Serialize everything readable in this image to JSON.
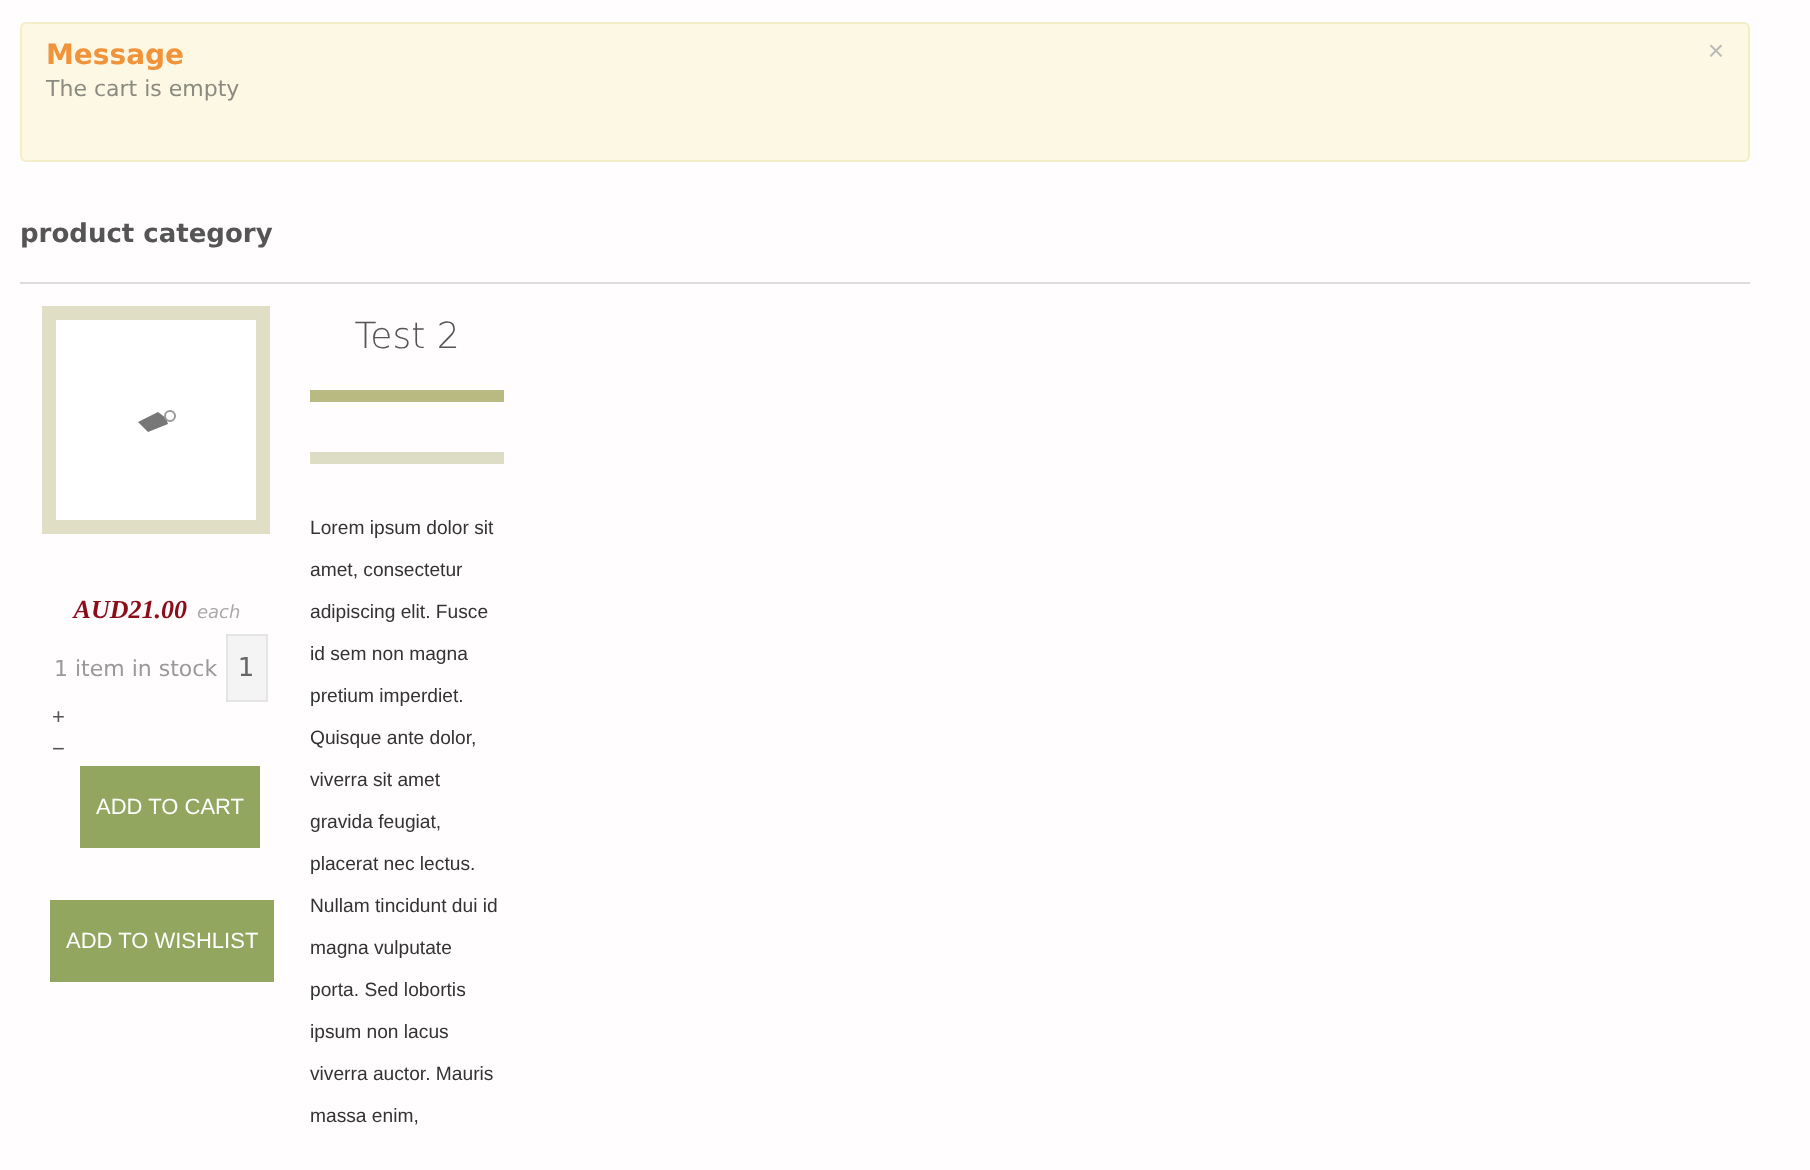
{
  "message": {
    "title": "Message",
    "text": "The cart is empty",
    "close": "×"
  },
  "category": {
    "title": "product category"
  },
  "product": {
    "name": "Test 2",
    "price": "AUD21.00",
    "unit": "each",
    "stock": "1 item in stock",
    "quantity": "1",
    "increase": "+",
    "decrease": "−",
    "buttons": [
      "ADD TO CART",
      "ADD TO WISHLIST"
    ],
    "description": "Lorem ipsum dolor sit amet, consectetur adipiscing elit. Fusce id sem non magna pretium imperdiet. Quisque ante dolor, viverra sit amet gravida feugiat, placerat nec lectus. Nullam tincidunt dui id magna vulputate porta. Sed lobortis ipsum non lacus viverra auctor. Mauris massa enim,"
  }
}
